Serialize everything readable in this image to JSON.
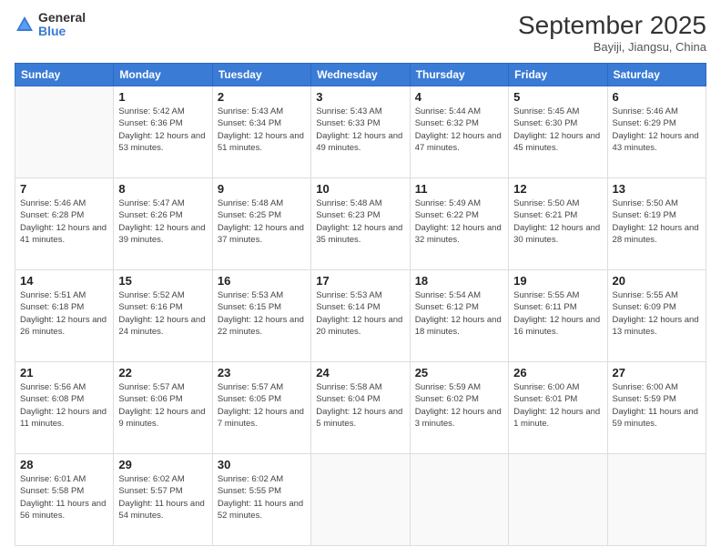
{
  "logo": {
    "line1": "General",
    "line2": "Blue"
  },
  "title": "September 2025",
  "location": "Bayiji, Jiangsu, China",
  "weekdays": [
    "Sunday",
    "Monday",
    "Tuesday",
    "Wednesday",
    "Thursday",
    "Friday",
    "Saturday"
  ],
  "weeks": [
    [
      {
        "day": "",
        "sunrise": "",
        "sunset": "",
        "daylight": ""
      },
      {
        "day": "1",
        "sunrise": "Sunrise: 5:42 AM",
        "sunset": "Sunset: 6:36 PM",
        "daylight": "Daylight: 12 hours and 53 minutes."
      },
      {
        "day": "2",
        "sunrise": "Sunrise: 5:43 AM",
        "sunset": "Sunset: 6:34 PM",
        "daylight": "Daylight: 12 hours and 51 minutes."
      },
      {
        "day": "3",
        "sunrise": "Sunrise: 5:43 AM",
        "sunset": "Sunset: 6:33 PM",
        "daylight": "Daylight: 12 hours and 49 minutes."
      },
      {
        "day": "4",
        "sunrise": "Sunrise: 5:44 AM",
        "sunset": "Sunset: 6:32 PM",
        "daylight": "Daylight: 12 hours and 47 minutes."
      },
      {
        "day": "5",
        "sunrise": "Sunrise: 5:45 AM",
        "sunset": "Sunset: 6:30 PM",
        "daylight": "Daylight: 12 hours and 45 minutes."
      },
      {
        "day": "6",
        "sunrise": "Sunrise: 5:46 AM",
        "sunset": "Sunset: 6:29 PM",
        "daylight": "Daylight: 12 hours and 43 minutes."
      }
    ],
    [
      {
        "day": "7",
        "sunrise": "Sunrise: 5:46 AM",
        "sunset": "Sunset: 6:28 PM",
        "daylight": "Daylight: 12 hours and 41 minutes."
      },
      {
        "day": "8",
        "sunrise": "Sunrise: 5:47 AM",
        "sunset": "Sunset: 6:26 PM",
        "daylight": "Daylight: 12 hours and 39 minutes."
      },
      {
        "day": "9",
        "sunrise": "Sunrise: 5:48 AM",
        "sunset": "Sunset: 6:25 PM",
        "daylight": "Daylight: 12 hours and 37 minutes."
      },
      {
        "day": "10",
        "sunrise": "Sunrise: 5:48 AM",
        "sunset": "Sunset: 6:23 PM",
        "daylight": "Daylight: 12 hours and 35 minutes."
      },
      {
        "day": "11",
        "sunrise": "Sunrise: 5:49 AM",
        "sunset": "Sunset: 6:22 PM",
        "daylight": "Daylight: 12 hours and 32 minutes."
      },
      {
        "day": "12",
        "sunrise": "Sunrise: 5:50 AM",
        "sunset": "Sunset: 6:21 PM",
        "daylight": "Daylight: 12 hours and 30 minutes."
      },
      {
        "day": "13",
        "sunrise": "Sunrise: 5:50 AM",
        "sunset": "Sunset: 6:19 PM",
        "daylight": "Daylight: 12 hours and 28 minutes."
      }
    ],
    [
      {
        "day": "14",
        "sunrise": "Sunrise: 5:51 AM",
        "sunset": "Sunset: 6:18 PM",
        "daylight": "Daylight: 12 hours and 26 minutes."
      },
      {
        "day": "15",
        "sunrise": "Sunrise: 5:52 AM",
        "sunset": "Sunset: 6:16 PM",
        "daylight": "Daylight: 12 hours and 24 minutes."
      },
      {
        "day": "16",
        "sunrise": "Sunrise: 5:53 AM",
        "sunset": "Sunset: 6:15 PM",
        "daylight": "Daylight: 12 hours and 22 minutes."
      },
      {
        "day": "17",
        "sunrise": "Sunrise: 5:53 AM",
        "sunset": "Sunset: 6:14 PM",
        "daylight": "Daylight: 12 hours and 20 minutes."
      },
      {
        "day": "18",
        "sunrise": "Sunrise: 5:54 AM",
        "sunset": "Sunset: 6:12 PM",
        "daylight": "Daylight: 12 hours and 18 minutes."
      },
      {
        "day": "19",
        "sunrise": "Sunrise: 5:55 AM",
        "sunset": "Sunset: 6:11 PM",
        "daylight": "Daylight: 12 hours and 16 minutes."
      },
      {
        "day": "20",
        "sunrise": "Sunrise: 5:55 AM",
        "sunset": "Sunset: 6:09 PM",
        "daylight": "Daylight: 12 hours and 13 minutes."
      }
    ],
    [
      {
        "day": "21",
        "sunrise": "Sunrise: 5:56 AM",
        "sunset": "Sunset: 6:08 PM",
        "daylight": "Daylight: 12 hours and 11 minutes."
      },
      {
        "day": "22",
        "sunrise": "Sunrise: 5:57 AM",
        "sunset": "Sunset: 6:06 PM",
        "daylight": "Daylight: 12 hours and 9 minutes."
      },
      {
        "day": "23",
        "sunrise": "Sunrise: 5:57 AM",
        "sunset": "Sunset: 6:05 PM",
        "daylight": "Daylight: 12 hours and 7 minutes."
      },
      {
        "day": "24",
        "sunrise": "Sunrise: 5:58 AM",
        "sunset": "Sunset: 6:04 PM",
        "daylight": "Daylight: 12 hours and 5 minutes."
      },
      {
        "day": "25",
        "sunrise": "Sunrise: 5:59 AM",
        "sunset": "Sunset: 6:02 PM",
        "daylight": "Daylight: 12 hours and 3 minutes."
      },
      {
        "day": "26",
        "sunrise": "Sunrise: 6:00 AM",
        "sunset": "Sunset: 6:01 PM",
        "daylight": "Daylight: 12 hours and 1 minute."
      },
      {
        "day": "27",
        "sunrise": "Sunrise: 6:00 AM",
        "sunset": "Sunset: 5:59 PM",
        "daylight": "Daylight: 11 hours and 59 minutes."
      }
    ],
    [
      {
        "day": "28",
        "sunrise": "Sunrise: 6:01 AM",
        "sunset": "Sunset: 5:58 PM",
        "daylight": "Daylight: 11 hours and 56 minutes."
      },
      {
        "day": "29",
        "sunrise": "Sunrise: 6:02 AM",
        "sunset": "Sunset: 5:57 PM",
        "daylight": "Daylight: 11 hours and 54 minutes."
      },
      {
        "day": "30",
        "sunrise": "Sunrise: 6:02 AM",
        "sunset": "Sunset: 5:55 PM",
        "daylight": "Daylight: 11 hours and 52 minutes."
      },
      {
        "day": "",
        "sunrise": "",
        "sunset": "",
        "daylight": ""
      },
      {
        "day": "",
        "sunrise": "",
        "sunset": "",
        "daylight": ""
      },
      {
        "day": "",
        "sunrise": "",
        "sunset": "",
        "daylight": ""
      },
      {
        "day": "",
        "sunrise": "",
        "sunset": "",
        "daylight": ""
      }
    ]
  ]
}
